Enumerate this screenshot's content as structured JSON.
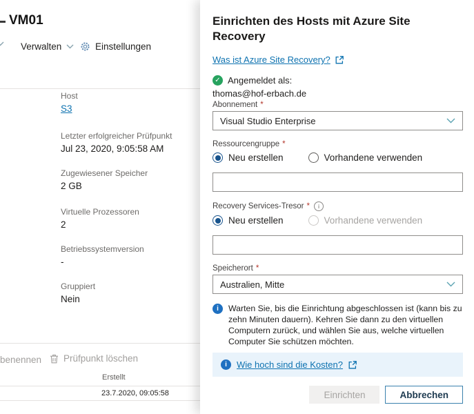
{
  "colors": {
    "accent_link": "#0d72b0",
    "chevron_teal": "#5ba3b2",
    "success_green": "#27a35f",
    "info_blue": "#1e70c1",
    "required_red": "#b3362b",
    "cost_box_bg": "#e9f3fb",
    "cancel_border_blue": "#3a81ad",
    "disabled_gray": "#a19f9d"
  },
  "glyphs": {
    "check": "✓",
    "info": "i"
  },
  "left": {
    "window_title": "VM01",
    "toolbar": {
      "manage_label": "Verwalten",
      "settings_label": "Einstellungen"
    },
    "details": [
      {
        "label": "Host",
        "value": "S3"
      },
      {
        "label": "Letzter erfolgreicher Prüfpunkt",
        "value": "Jul 23, 2020, 9:05:58 AM"
      },
      {
        "label": "Zugewiesener Speicher",
        "value": "2 GB"
      },
      {
        "label": "Virtuelle Prozessoren",
        "value": "2"
      },
      {
        "label": "Betriebssystemversion",
        "value": "-"
      },
      {
        "label": "Gruppiert",
        "value": "Nein"
      }
    ],
    "footer_toolbar": {
      "rename_label": "benennen",
      "delete_checkpoint_label": "Prüfpunkt löschen"
    },
    "checkpoint_table": {
      "created_header": "Erstellt",
      "created_value": "23.7.2020, 09:05:58"
    }
  },
  "panel": {
    "title": "Einrichten des Hosts mit Azure Site Recovery",
    "learn_more_link": "Was ist Azure Site Recovery?",
    "signed_in_label": "Angemeldet als:",
    "signed_in_email": "thomas@hof-erbach.de",
    "required_marker": "*",
    "subscription": {
      "label": "Abonnement",
      "value": "Visual Studio Enterprise"
    },
    "resource_group": {
      "label": "Ressourcengruppe",
      "create_new": "Neu erstellen",
      "use_existing": "Vorhandene verwenden",
      "input_value": ""
    },
    "vault": {
      "label": "Recovery Services-Tresor",
      "create_new": "Neu erstellen",
      "use_existing": "Vorhandene verwenden",
      "input_value": ""
    },
    "location": {
      "label": "Speicherort",
      "value": "Australien, Mitte"
    },
    "wait_note": "Warten Sie, bis die Einrichtung abgeschlossen ist (kann bis zu zehn Minuten dauern). Kehren Sie dann zu den virtuellen Computern zurück, und wählen Sie aus, welche virtuellen Computer Sie schützen möchten.",
    "cost_link": "Wie hoch sind die Kosten?",
    "setup_button": "Einrichten",
    "cancel_button": "Abbrechen"
  }
}
